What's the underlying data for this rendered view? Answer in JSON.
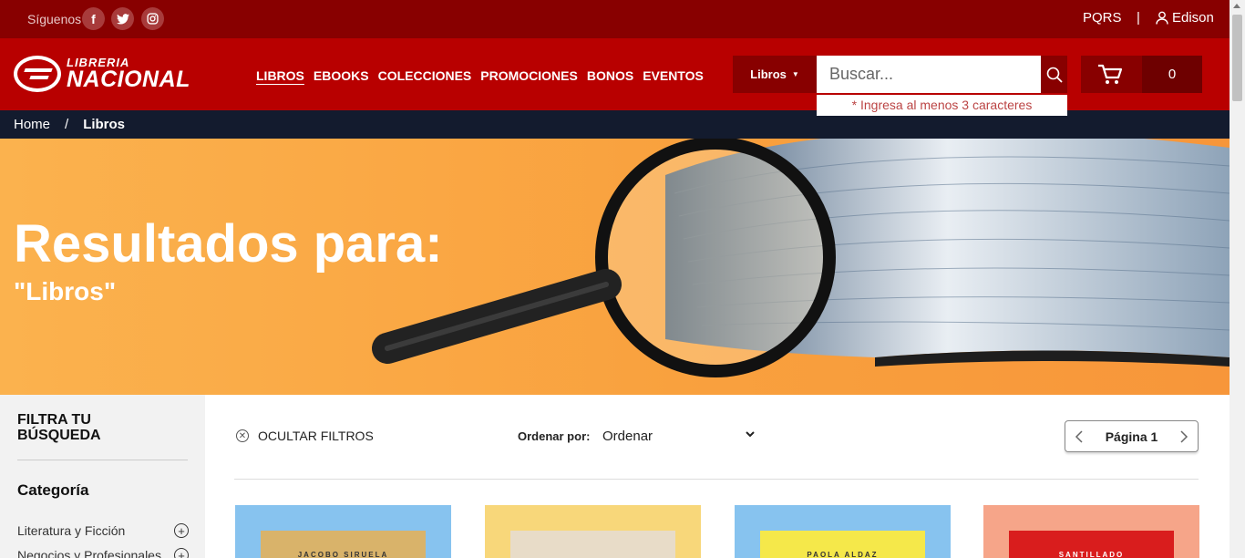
{
  "topbar": {
    "follow_label": "Síguenos",
    "social": [
      "facebook-icon",
      "twitter-icon",
      "instagram-icon"
    ],
    "pqrs": "PQRS",
    "separator": "|",
    "user_name": "Edison"
  },
  "header": {
    "logo_top": "LIBRERIA",
    "logo_bottom": "NACIONAL",
    "nav": [
      "LIBROS",
      "EBOOKS",
      "COLECCIONES",
      "PROMOCIONES",
      "BONOS",
      "EVENTOS"
    ],
    "search": {
      "category": "Libros",
      "placeholder": "Buscar...",
      "hint": "* Ingresa al menos 3 caracteres"
    },
    "cart_count": "0"
  },
  "breadcrumb": {
    "home": "Home",
    "separator": "/",
    "current": "Libros"
  },
  "hero": {
    "title": "Resultados para:",
    "query": "\"Libros\""
  },
  "sidebar": {
    "title": "FILTRA TU BÚSQUEDA",
    "category_title": "Categoría",
    "categories": [
      "Literatura y Ficción",
      "Negocios y Profesionales"
    ]
  },
  "toolbar": {
    "hide_filters": "OCULTAR FILTROS",
    "sort_label": "Ordenar por:",
    "sort_value": "Ordenar",
    "page_label": "Página 1"
  },
  "products": [
    {
      "bg": "#87c3ef",
      "cover": "#d9b36a",
      "cover_text": "JACOBO SIRUELA"
    },
    {
      "bg": "#f8d77a",
      "cover": "#e8dcc8",
      "cover_text": ""
    },
    {
      "bg": "#87c3ef",
      "cover": "#f5e84a",
      "cover_text": "PAOLA ALDAZ"
    },
    {
      "bg": "#f6a589",
      "cover": "#d91d1d",
      "cover_text": "SANTILLADO"
    }
  ],
  "colors": {
    "topbar": "#880000",
    "header": "#b80000",
    "breadcrumb": "#131b2e",
    "hero": "#f9a13e"
  }
}
